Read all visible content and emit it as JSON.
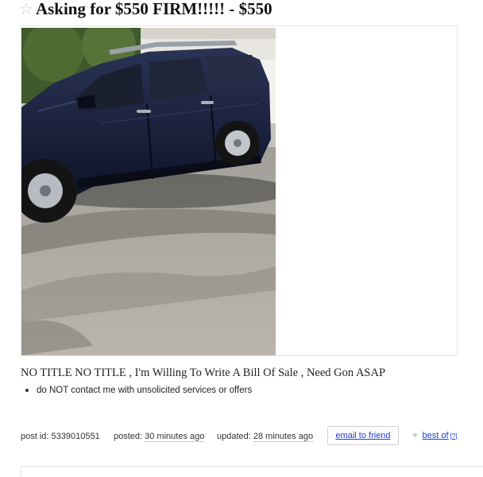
{
  "posting": {
    "title": "Asking for $550 FIRM!!!!! - $550",
    "star_glyph": "☆",
    "body": "NO TITLE NO TITLE , I'm Willing To Write A Bill Of Sale , Need Gon ASAP",
    "notices": [
      "do NOT contact me with unsolicited services or offers"
    ]
  },
  "photo": {
    "icon": "car-photo"
  },
  "meta": {
    "post_id_label": "post id: 5339010551",
    "posted_label": "posted: ",
    "posted_value": "30 minutes ago",
    "updated_label": "updated: ",
    "updated_value": "28 minutes ago",
    "email_label": "email to friend",
    "heart_glyph": "♥",
    "best_of_label": "best of",
    "best_of_sup": "[?]"
  },
  "colors": {
    "link": "#1b3fd8",
    "car_body": "#141b33"
  }
}
